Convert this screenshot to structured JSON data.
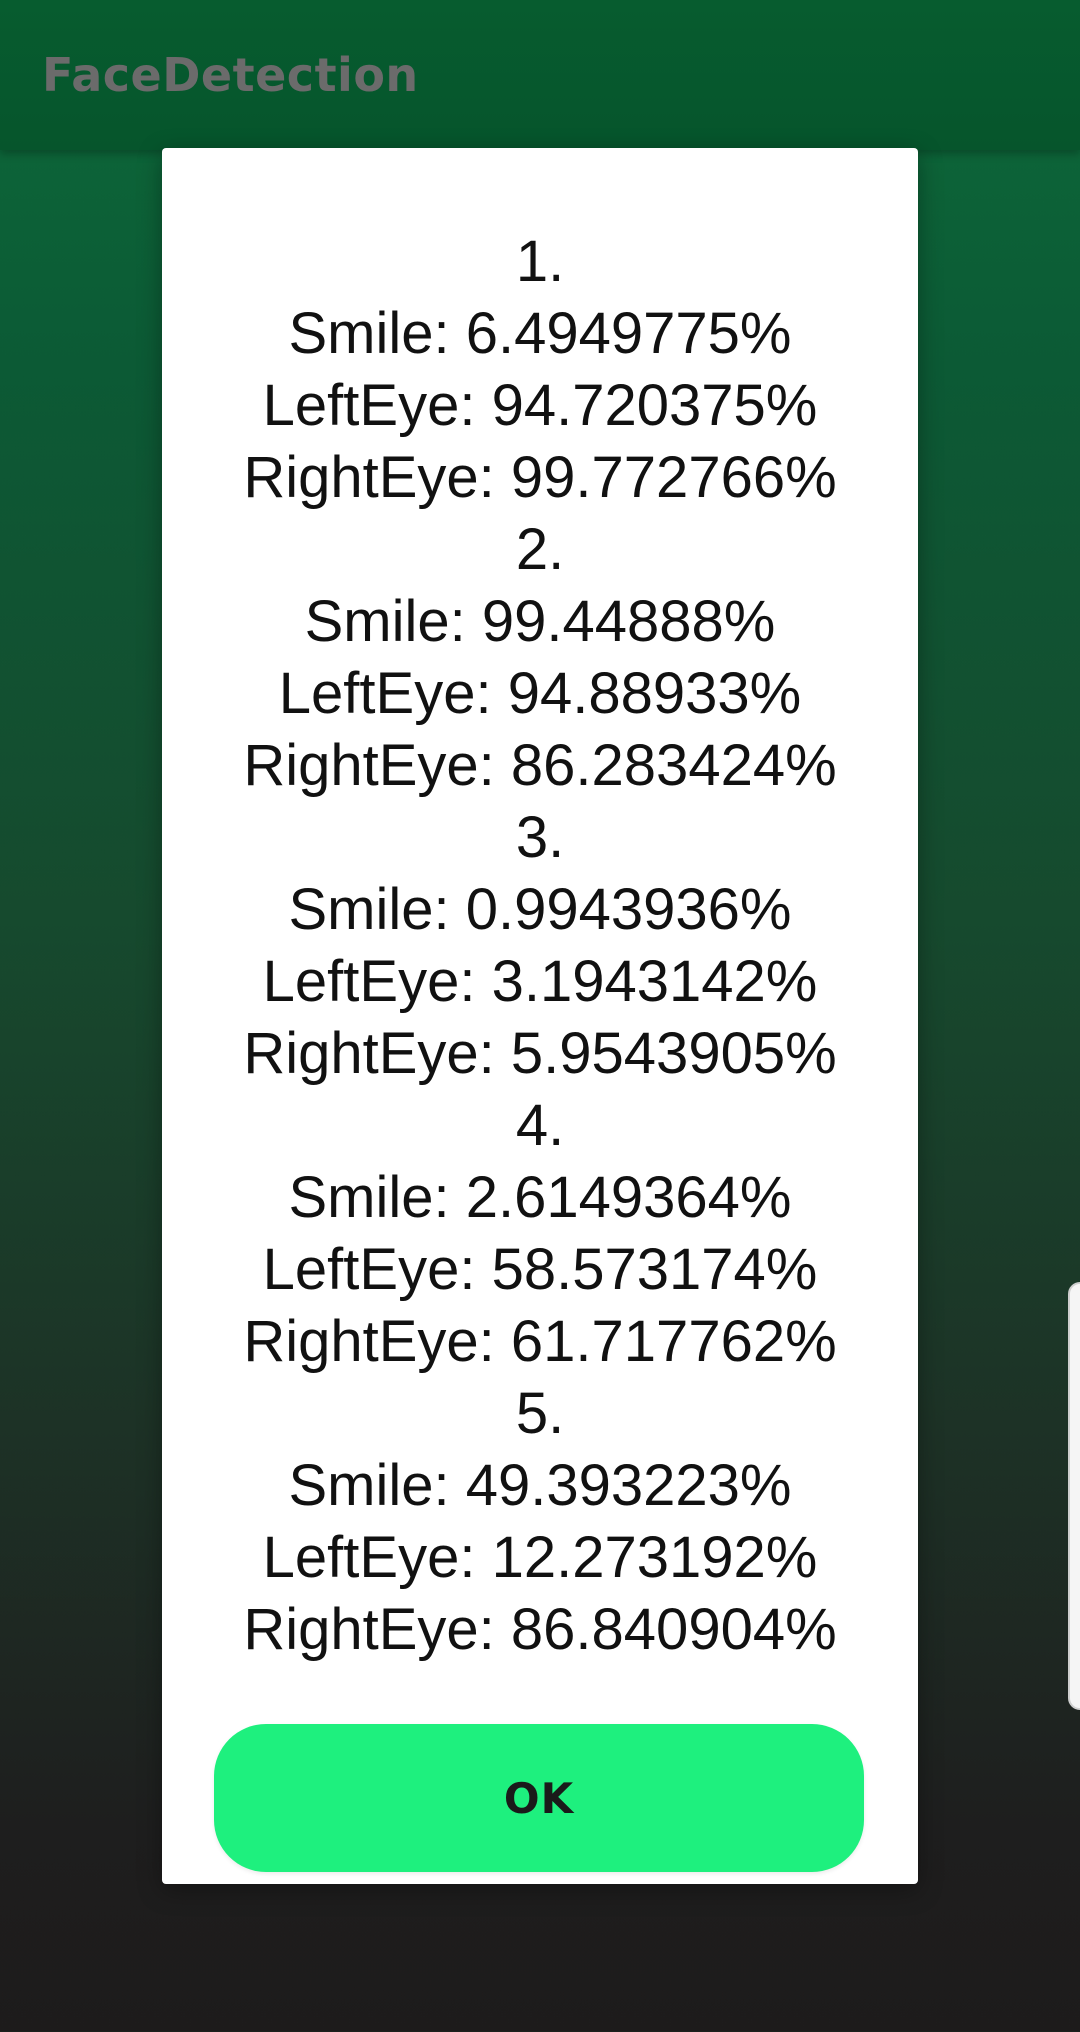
{
  "app": {
    "title": "FaceDetection"
  },
  "dialog": {
    "results": [
      {
        "index": "1.",
        "smile": "Smile: 6.4949775%",
        "left_eye": "LeftEye: 94.720375%",
        "right_eye": "RightEye: 99.772766%"
      },
      {
        "index": "2.",
        "smile": "Smile: 99.44888%",
        "left_eye": "LeftEye: 94.88933%",
        "right_eye": "RightEye: 86.283424%"
      },
      {
        "index": "3.",
        "smile": "Smile: 0.9943936%",
        "left_eye": "LeftEye: 3.1943142%",
        "right_eye": "RightEye: 5.9543905%"
      },
      {
        "index": "4.",
        "smile": "Smile: 2.6149364%",
        "left_eye": "LeftEye: 58.573174%",
        "right_eye": "RightEye: 61.717762%"
      },
      {
        "index": "5.",
        "smile": "Smile: 49.393223%",
        "left_eye": "LeftEye: 12.273192%",
        "right_eye": "RightEye: 86.840904%"
      }
    ],
    "ok_label": "OK"
  },
  "colors": {
    "app_bar": "#075c2f",
    "dialog_bg": "#ffffff",
    "ok_button": "#1ef07e",
    "title_text": "#6b6b6b"
  }
}
